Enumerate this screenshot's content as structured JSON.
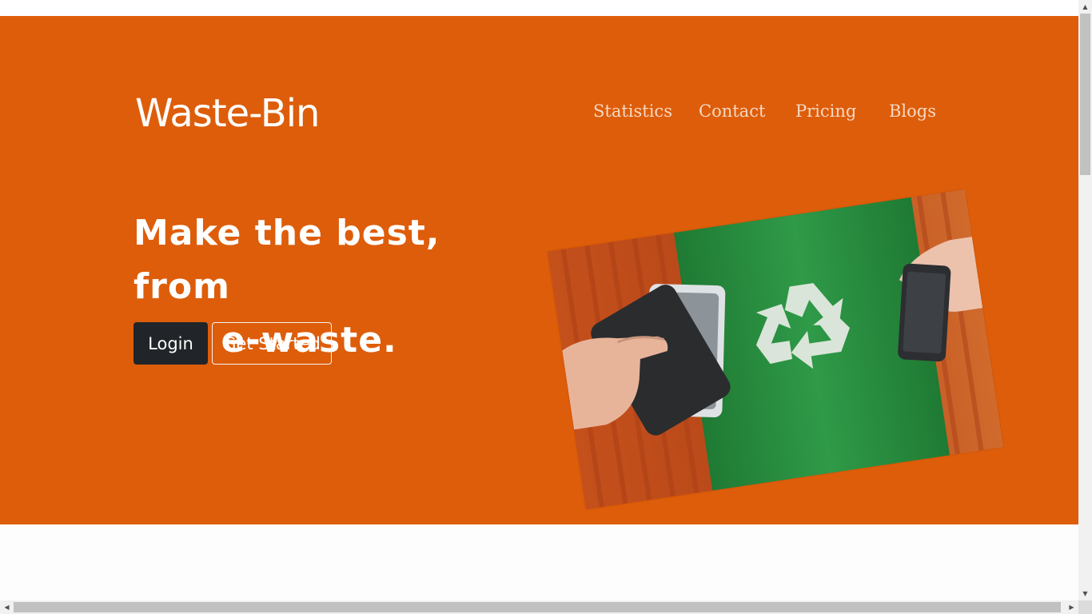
{
  "brand": {
    "name": "Waste-Bin"
  },
  "nav": {
    "items": [
      {
        "label": "Statistics"
      },
      {
        "label": "Contact"
      },
      {
        "label": "Pricing"
      },
      {
        "label": "Blogs"
      }
    ]
  },
  "hero": {
    "headline_line1": "Make the best, from",
    "headline_line2": "you e-waste.",
    "login_label": "Login",
    "get_started_label": "Get Started",
    "image_icon": "recycle-bin-phones-photo"
  },
  "colors": {
    "hero_background": "#de5d0a",
    "login_button": "#212529",
    "nav_text": "#f6d9c4",
    "photo_green": "#2f8f43"
  }
}
